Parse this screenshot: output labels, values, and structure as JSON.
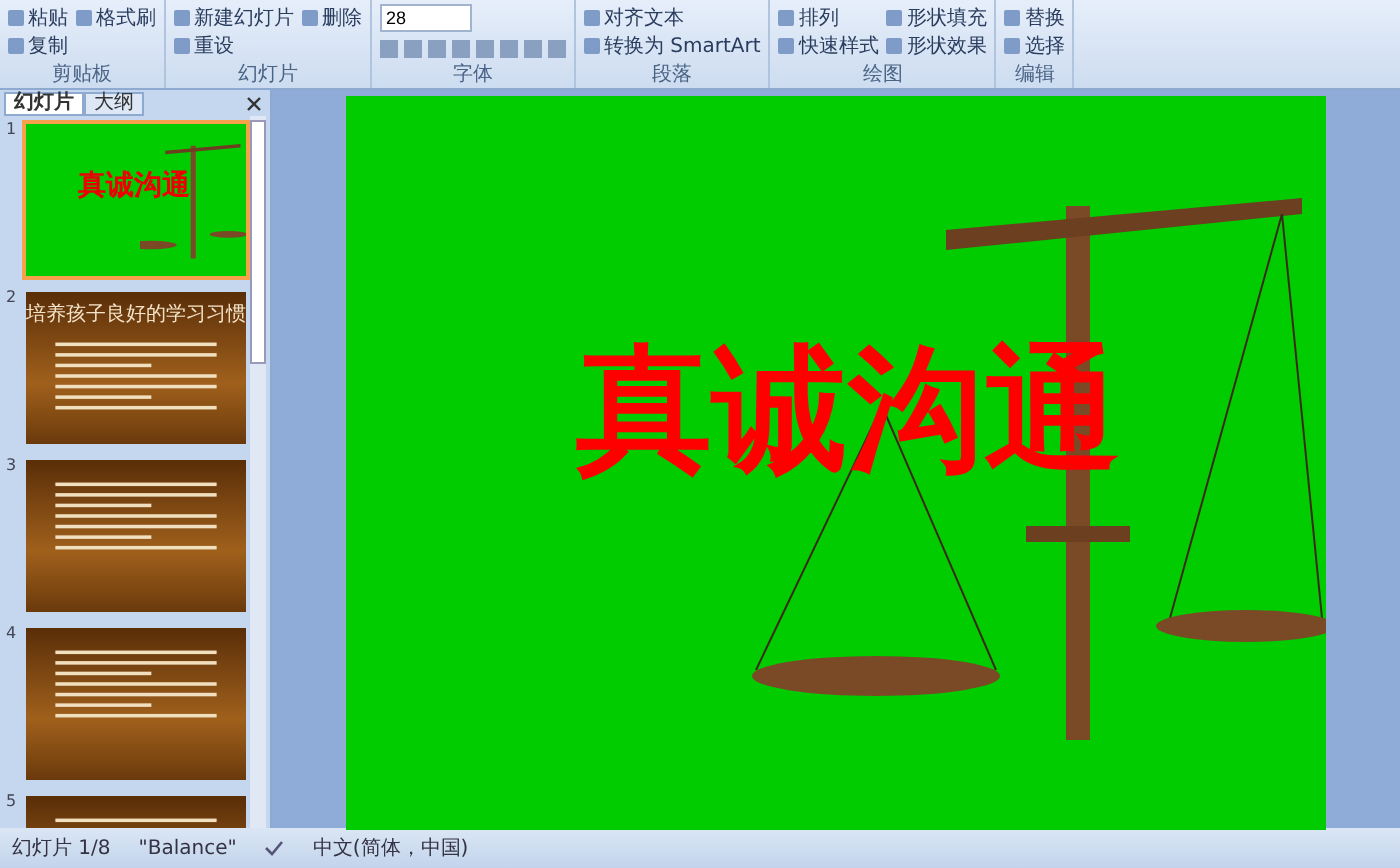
{
  "ribbon": {
    "font_size": "28",
    "groups": [
      {
        "label": "剪贴板",
        "items": [
          "粘贴",
          "复制",
          "格式刷"
        ]
      },
      {
        "label": "幻灯片",
        "items": [
          "新建幻灯片",
          "重设",
          "删除"
        ]
      },
      {
        "label": "字体"
      },
      {
        "label": "段落",
        "items": [
          "对齐文本",
          "转换为 SmartArt"
        ]
      },
      {
        "label": "绘图",
        "items": [
          "排列",
          "快速样式",
          "形状填充",
          "形状效果"
        ]
      },
      {
        "label": "编辑",
        "items": [
          "替换",
          "选择"
        ]
      }
    ]
  },
  "panel": {
    "tabs": [
      {
        "label": "幻灯片",
        "selected": true
      },
      {
        "label": "大纲",
        "selected": false
      }
    ],
    "thumbnails": [
      {
        "number": "1",
        "kind": "title",
        "selected": true,
        "title": "真诚沟通"
      },
      {
        "number": "2",
        "kind": "text",
        "selected": false,
        "title": "培养孩子良好的学习习惯"
      },
      {
        "number": "3",
        "kind": "text",
        "selected": false
      },
      {
        "number": "4",
        "kind": "text",
        "selected": false
      },
      {
        "number": "5",
        "kind": "text",
        "selected": false
      }
    ]
  },
  "slide": {
    "title": "真诚沟通"
  },
  "status_bar": {
    "slide": "幻灯片 1/8",
    "theme": "\"Balance\"",
    "language": "中文(简体，中国)"
  }
}
